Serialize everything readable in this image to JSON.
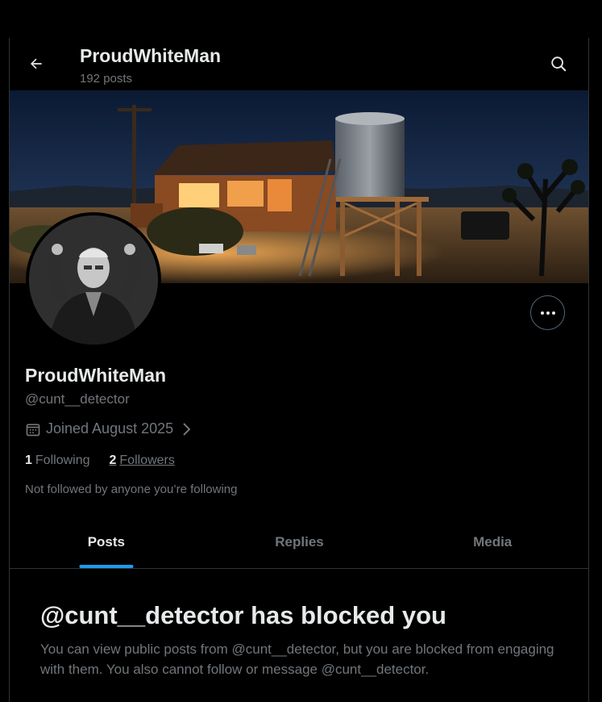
{
  "header": {
    "title": "ProudWhiteMan",
    "post_count": "192 posts"
  },
  "profile": {
    "display_name": "ProudWhiteMan",
    "handle": "@cunt__detector",
    "joined": "Joined August 2025",
    "following_count": "1",
    "following_label": "Following",
    "followers_count": "2",
    "followers_label": "Followers",
    "not_followed_note": "Not followed by anyone you’re following"
  },
  "tabs": [
    {
      "label": "Posts",
      "active": true
    },
    {
      "label": "Replies",
      "active": false
    },
    {
      "label": "Media",
      "active": false
    }
  ],
  "blocked": {
    "title": "@cunt__detector has blocked you",
    "message": "You can view public posts from @cunt__detector, but you are blocked from engaging with them. You also cannot follow or message @cunt__detector."
  },
  "icons": {
    "back": "arrow-left-icon",
    "search": "search-icon",
    "more": "more-horizontal-icon",
    "calendar": "calendar-icon",
    "chevron": "chevron-right-icon"
  },
  "colors": {
    "background": "#000000",
    "primary_text": "#e7e9ea",
    "secondary_text": "#71767b",
    "accent": "#1d9bf0",
    "border": "#2f3336"
  }
}
